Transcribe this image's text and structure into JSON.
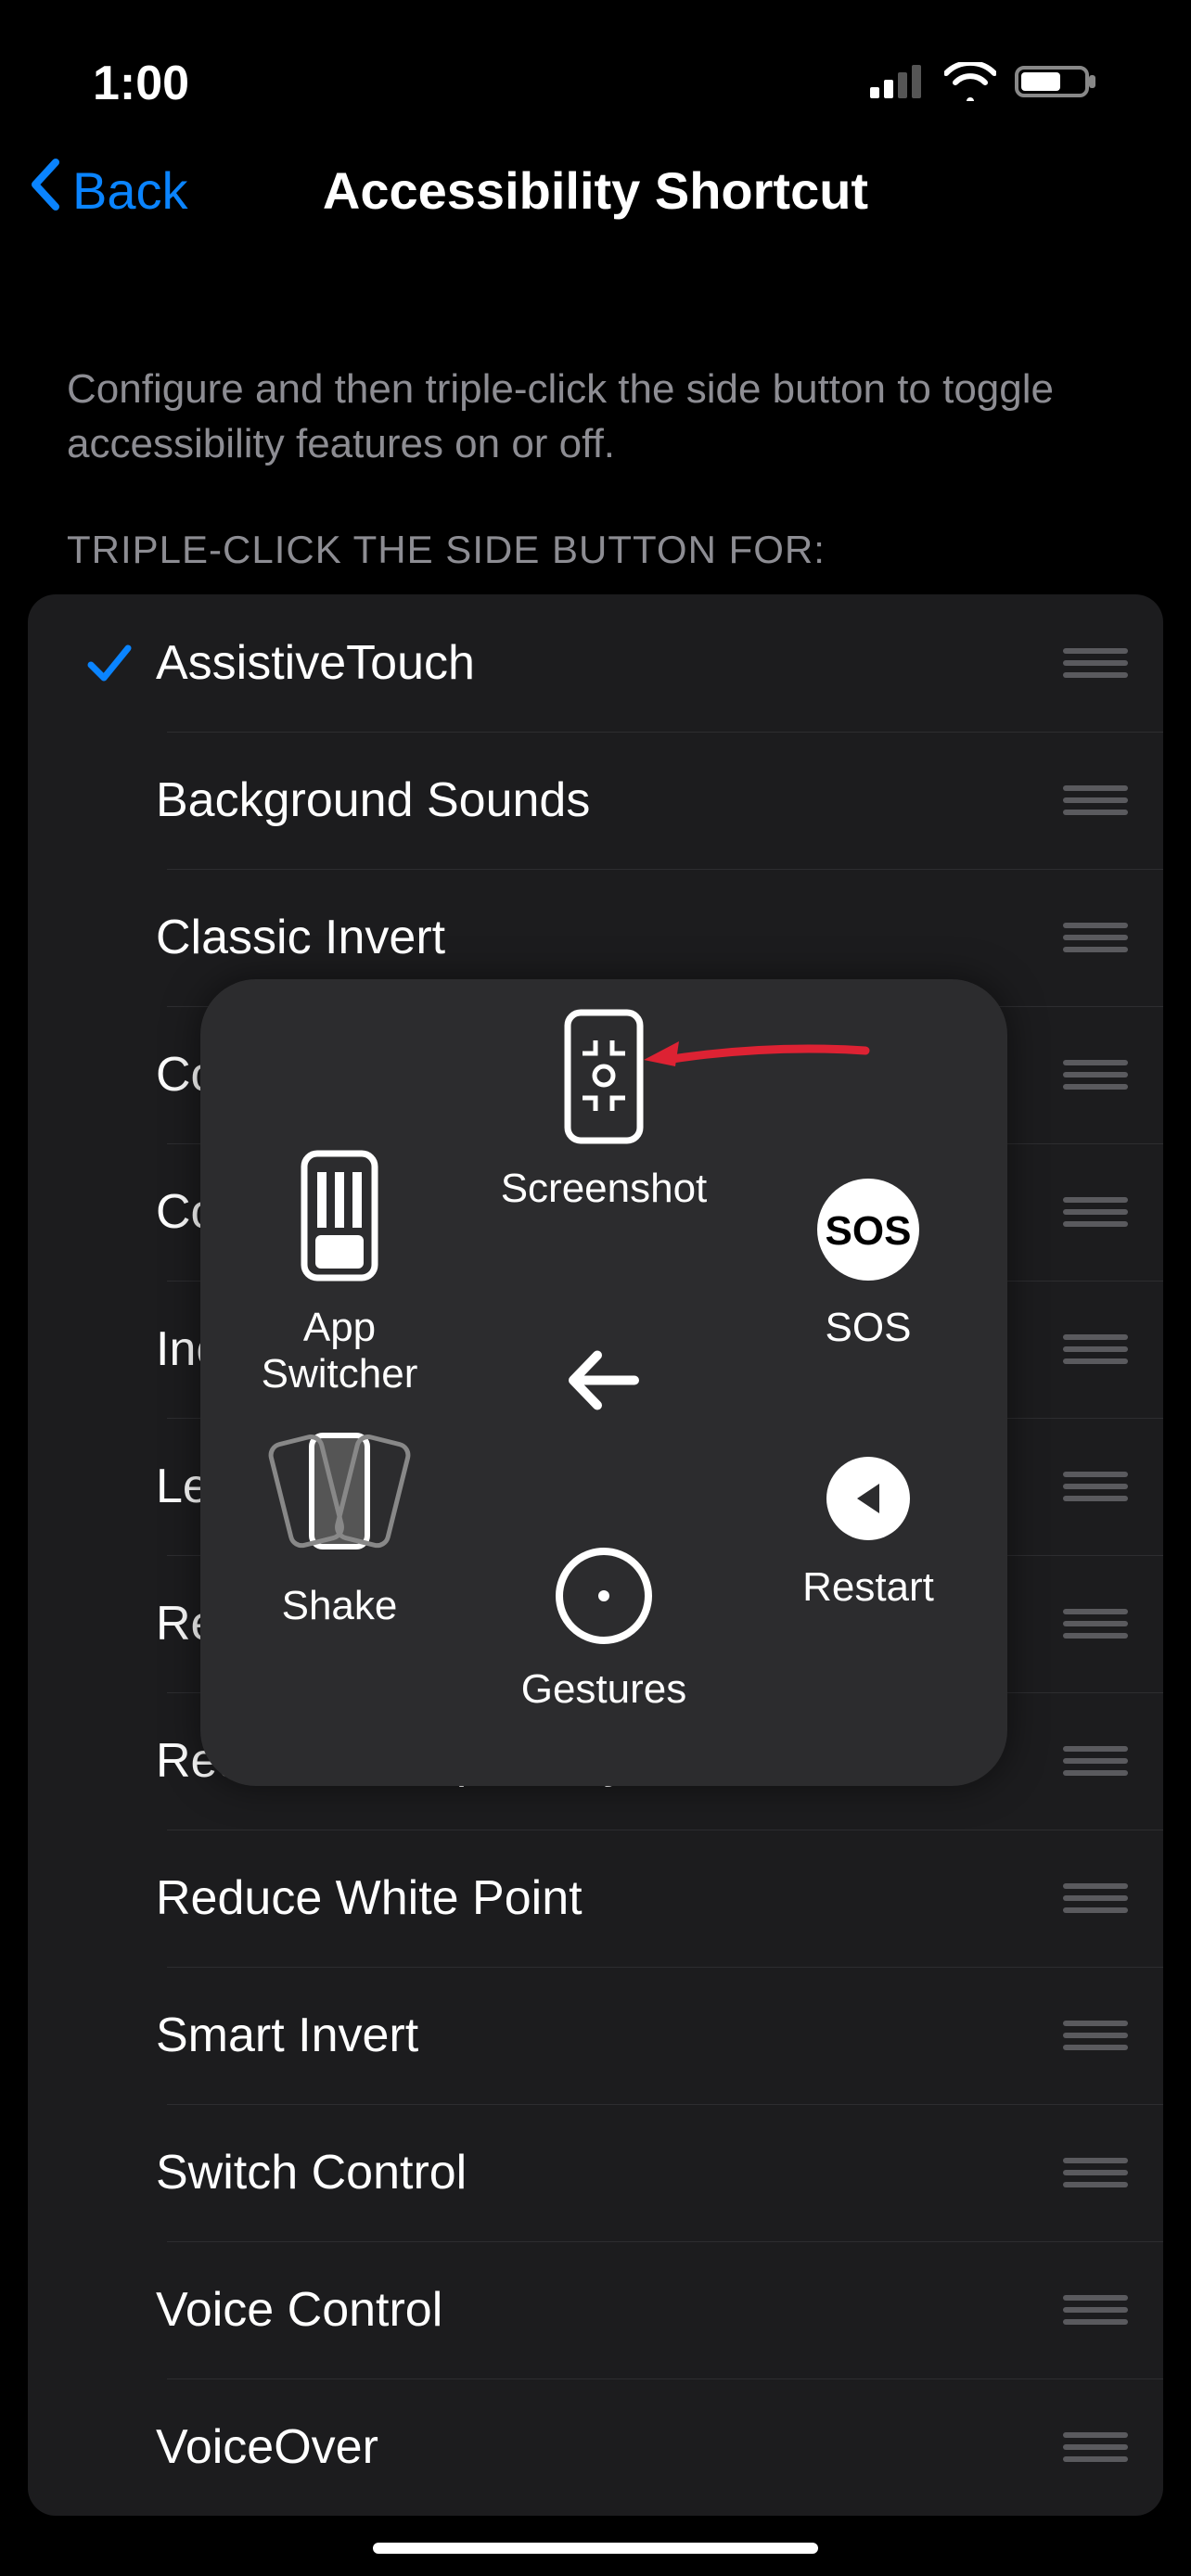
{
  "status": {
    "time": "1:00"
  },
  "nav": {
    "back_label": "Back",
    "title": "Accessibility Shortcut"
  },
  "section": {
    "description": "Configure and then triple-click the side button to toggle accessibility features on or off.",
    "subtitle": "TRIPLE-CLICK THE SIDE BUTTON FOR:"
  },
  "options": [
    {
      "label": "AssistiveTouch",
      "checked": true
    },
    {
      "label": "Background Sounds",
      "checked": false
    },
    {
      "label": "Classic Invert",
      "checked": false
    },
    {
      "label": "Color Filters",
      "checked": false
    },
    {
      "label": "Control Nearby Devices",
      "checked": false
    },
    {
      "label": "Increase Contrast",
      "checked": false
    },
    {
      "label": "Left/Right Balance",
      "checked": false
    },
    {
      "label": "Reduce Motion",
      "checked": false
    },
    {
      "label": "Reduce Transparency",
      "checked": false
    },
    {
      "label": "Reduce White Point",
      "checked": false
    },
    {
      "label": "Smart Invert",
      "checked": false
    },
    {
      "label": "Switch Control",
      "checked": false
    },
    {
      "label": "Voice Control",
      "checked": false
    },
    {
      "label": "VoiceOver",
      "checked": false
    }
  ],
  "assistive_menu": {
    "screenshot": "Screenshot",
    "app_switcher": "App Switcher",
    "sos": "SOS",
    "shake": "Shake",
    "restart": "Restart",
    "gestures": "Gestures"
  }
}
